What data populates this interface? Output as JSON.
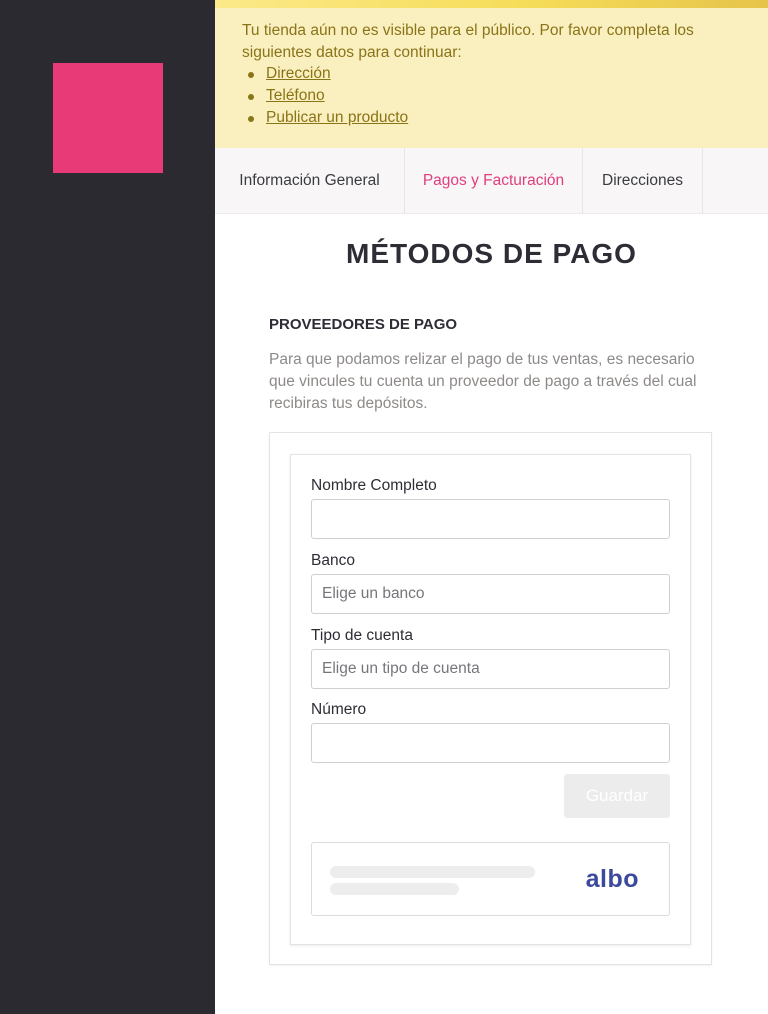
{
  "brand": {
    "logo_color": "#e83a76",
    "sidebar_color": "#2b2a31"
  },
  "banner": {
    "message": "Tu tienda aún no es visible para el público. Por favor completa los siguientes datos para continuar:",
    "items": [
      {
        "label": "Dirección"
      },
      {
        "label": "Teléfono"
      },
      {
        "label": "Publicar un producto"
      }
    ]
  },
  "tabs": [
    {
      "label": "Información General",
      "active": false
    },
    {
      "label": "Pagos y Facturación",
      "active": true
    },
    {
      "label": "Direcciones",
      "active": false
    }
  ],
  "page": {
    "title": "MÉTODOS DE PAGO",
    "section_title": "PROVEEDORES DE PAGO",
    "section_description": "Para que podamos relizar el pago de tus ventas, es necesario que vincules tu cuenta un proveedor de pago a través del cual recibiras tus depósitos."
  },
  "form": {
    "full_name": {
      "label": "Nombre Completo",
      "value": "",
      "placeholder": ""
    },
    "bank": {
      "label": "Banco",
      "value": "",
      "placeholder": "Elige un banco"
    },
    "account_type": {
      "label": "Tipo de cuenta",
      "value": "",
      "placeholder": "Elige un tipo de cuenta"
    },
    "number": {
      "label": "Número",
      "value": "",
      "placeholder": ""
    },
    "save_label": "Guardar"
  },
  "provider": {
    "logo_text": "albo",
    "logo_color": "#3c4a9c"
  },
  "colors": {
    "accent": "#e03e7e",
    "banner_bg": "#faefbf",
    "banner_text": "#8a7418"
  }
}
